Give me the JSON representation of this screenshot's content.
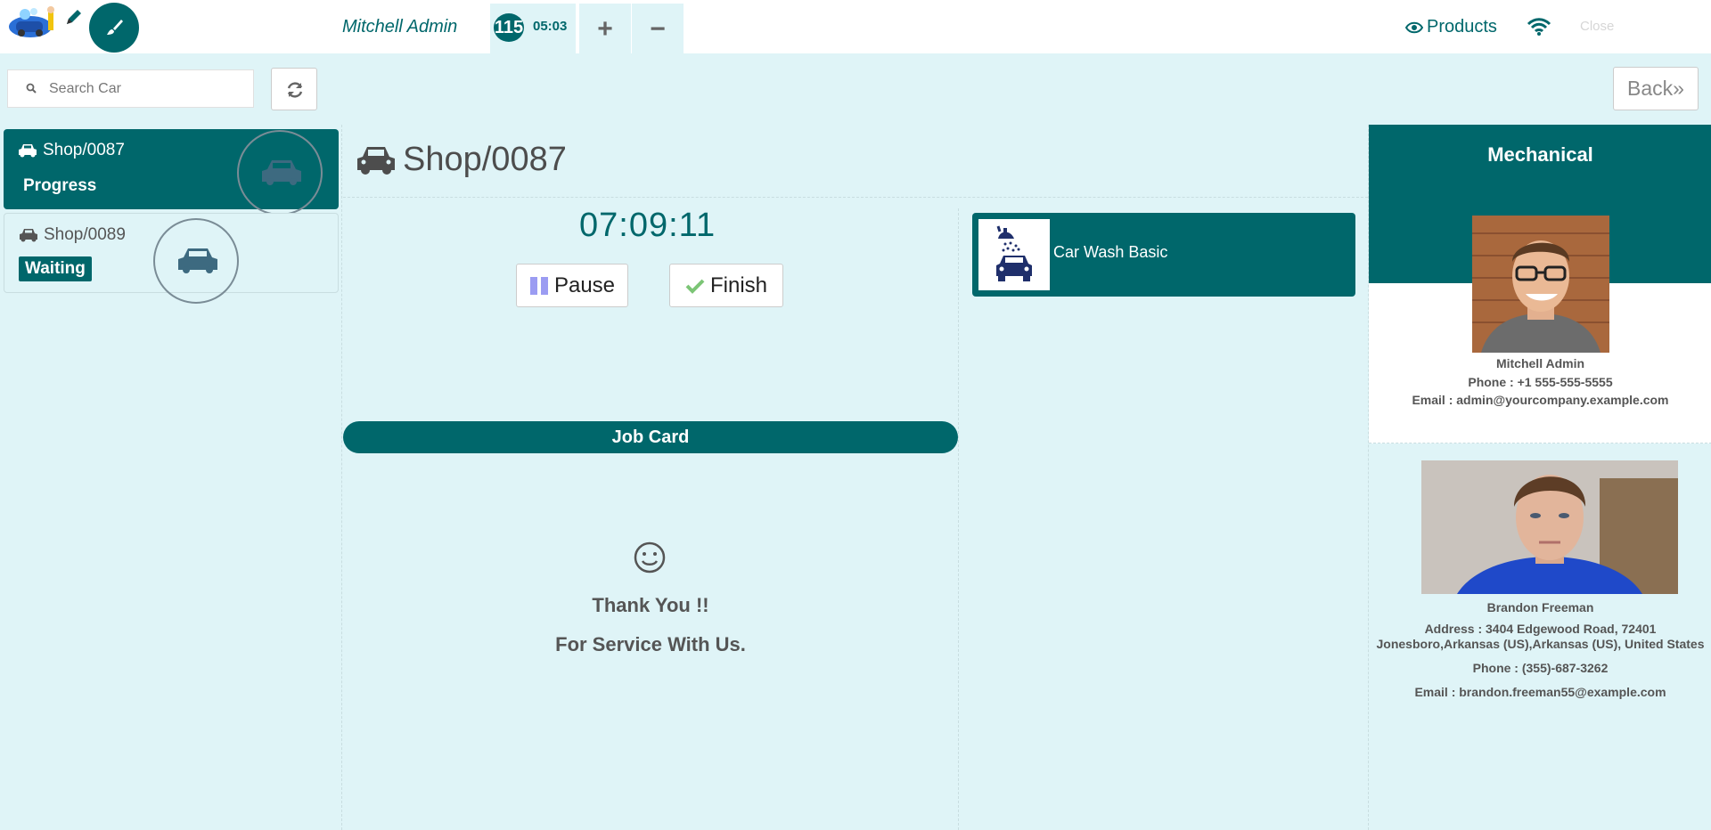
{
  "topbar": {
    "user_name": "Mitchell Admin",
    "order_badge": "115",
    "order_time": "05:03",
    "add_label": "+",
    "remove_label": "−",
    "products_label": "Products",
    "close_label": "Close"
  },
  "search": {
    "placeholder": "Search Car"
  },
  "back_label": "Back»",
  "cars": [
    {
      "name": "Shop/0087",
      "state": "Progress",
      "active": true
    },
    {
      "name": "Shop/0089",
      "state": "Waiting",
      "active": false
    }
  ],
  "detail": {
    "title": "Shop/0087",
    "timer": "07:09:11",
    "pause_label": "Pause",
    "finish_label": "Finish",
    "job_card_label": "Job Card",
    "thanks_line1": "Thank You !!",
    "thanks_line2": "For Service With Us."
  },
  "service": {
    "name": "Car Wash Basic"
  },
  "mechanic": {
    "section_title": "Mechanical",
    "name": "Mitchell Admin",
    "phone": "Phone : +1 555-555-5555",
    "email": "Email : admin@yourcompany.example.com"
  },
  "customer": {
    "name": "Brandon Freeman",
    "address_line1": "Address : 3404 Edgewood Road, 72401",
    "address_line2": "Jonesboro,Arkansas (US),Arkansas (US), United States",
    "phone": "Phone : (355)-687-3262",
    "email": "Email : brandon.freeman55@example.com"
  },
  "colors": {
    "primary": "#00676b",
    "background": "#dff4f7"
  }
}
